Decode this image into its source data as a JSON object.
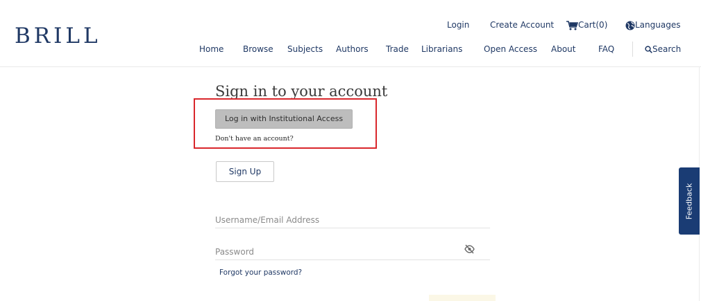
{
  "brand": {
    "logo_text": "BRILL"
  },
  "util_nav": {
    "login": "Login",
    "create_account": "Create Account",
    "cart": "Cart(0)",
    "languages": "Languages"
  },
  "main_nav": {
    "home": "Home",
    "browse": "Browse",
    "subjects": "Subjects",
    "authors": "Authors",
    "trade": "Trade",
    "librarians": "Librarians",
    "open_access": "Open Access",
    "about": "About",
    "faq": "FAQ",
    "search": "Search"
  },
  "signin": {
    "title": "Sign in to your account",
    "institutional_button": "Log in with Institutional Access",
    "no_account_text": "Don't have an account?",
    "signup_button": "Sign Up",
    "username_placeholder": "Username/Email Address",
    "password_placeholder": "Password",
    "forgot_link": "Forgot your password?"
  },
  "feedback": {
    "label": "Feedback"
  },
  "colors": {
    "brand_navy": "#1f3864",
    "highlight_red": "#d9262b",
    "feedback_bg": "#1a3c74"
  },
  "icons": {
    "cart": "cart-icon",
    "languages": "globe-icon",
    "search": "search-icon",
    "password_toggle": "eye-slash-icon"
  }
}
